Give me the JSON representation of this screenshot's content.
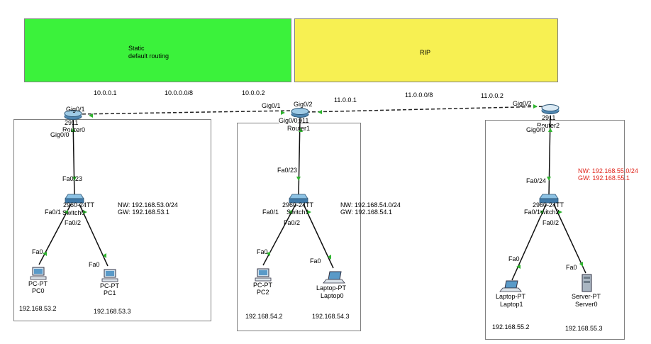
{
  "areas": {
    "static": {
      "label": "Static\ndefault routing",
      "color": "#3bf23b"
    },
    "rip": {
      "label": "RIP",
      "color": "#f7f052"
    }
  },
  "links": {
    "r0_r1": {
      "left_ip": "10.0.0.1",
      "network": "10.0.0.0/8",
      "right_ip": "10.0.0.2"
    },
    "r1_r2": {
      "left_ip": "11.0.0.1",
      "network": "11.0.0.0/8",
      "right_ip": "11.0.0.2"
    }
  },
  "routers": {
    "r0": {
      "model": "2911",
      "name": "Router0",
      "port_wan": "Gig0/1",
      "port_lan": "Gig0/0"
    },
    "r1": {
      "model": "2911",
      "name": "Router1",
      "port_wan_left": "Gig0/1",
      "port_wan_right": "Gig0/2",
      "port_lan": "Gig0/0"
    },
    "r2": {
      "model": "2911",
      "name": "Router2",
      "port_wan": "Gig0/2",
      "port_lan": "Gig0/0"
    }
  },
  "switches": {
    "s0": {
      "model": "2960-24TT",
      "name": "Switch0",
      "uplink": "Fa0/23",
      "port_a": "Fa0/1",
      "port_b": "Fa0/2"
    },
    "s1": {
      "model": "2960-24TT",
      "name": "Switch1",
      "uplink": "Fa0/23",
      "port_a": "Fa0/1",
      "port_b": "Fa0/2"
    },
    "s2": {
      "model": "2960-24TT",
      "name": "Switch2",
      "uplink": "Fa0/24",
      "port_a": "Fa0/1",
      "port_b": "Fa0/2"
    }
  },
  "subnets": {
    "lan0": {
      "nw": "NW: 192.168.53.0/24",
      "gw": "GW: 192.168.53.1"
    },
    "lan1": {
      "nw": "NW: 192.168.54.0/24",
      "gw": "GW: 192.168.54.1"
    },
    "lan2": {
      "nw": "NW: 192.168.55.0/24",
      "gw": "GW: 192.168.55.1",
      "color": "#e0241b"
    }
  },
  "hosts": {
    "pc0": {
      "type": "PC-PT",
      "name": "PC0",
      "port": "Fa0",
      "ip": "192.168.53.2"
    },
    "pc1": {
      "type": "PC-PT",
      "name": "PC1",
      "port": "Fa0",
      "ip": "192.168.53.3"
    },
    "pc2": {
      "type": "PC-PT",
      "name": "PC2",
      "port": "Fa0",
      "ip": "192.168.54.2"
    },
    "laptop0": {
      "type": "Laptop-PT",
      "name": "Laptop0",
      "port": "Fa0",
      "ip": "192.168.54.3"
    },
    "laptop1": {
      "type": "Laptop-PT",
      "name": "Laptop1",
      "port": "Fa0",
      "ip": "192.168.55.2"
    },
    "server0": {
      "type": "Server-PT",
      "name": "Server0",
      "port": "Fa0",
      "ip": "192.168.55.3"
    }
  }
}
